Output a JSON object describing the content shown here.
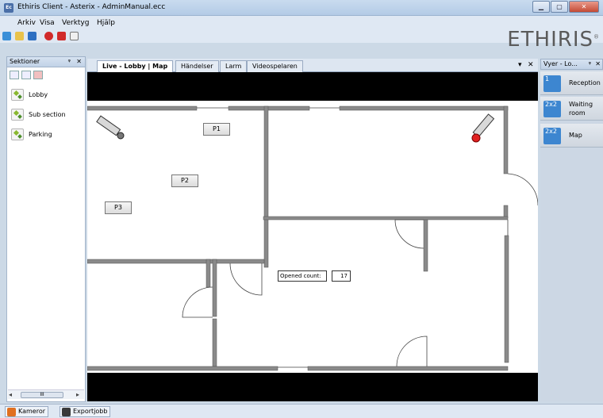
{
  "window": {
    "title": "Ethiris Client - Asterix - AdminManual.ecc",
    "app_icon": "Ec"
  },
  "menu": [
    "Arkiv",
    "Visa",
    "Verktyg",
    "Hjälp"
  ],
  "logo": {
    "text": "ETHIRIS",
    "mark": "®"
  },
  "sections_panel": {
    "title": "Sektioner",
    "items": [
      "Lobby",
      "Sub section",
      "Parking"
    ],
    "scroll_label": "III"
  },
  "tabs": [
    "Live - Lobby | Map",
    "Händelser",
    "Larm",
    "Videospelaren"
  ],
  "views_panel": {
    "title": "Vyer - Lo...",
    "items": [
      {
        "icon_text": "1",
        "label": "Reception"
      },
      {
        "icon_text": "2x2",
        "label": "Waiting room"
      },
      {
        "icon_text": "2x2",
        "label": "Map"
      }
    ]
  },
  "map": {
    "buttons": [
      "P1",
      "P2",
      "P3"
    ],
    "counter_label": "Opened count:",
    "counter_value": "17"
  },
  "bottom_tabs": [
    "Kameror",
    "Exportjobb"
  ],
  "colors": {
    "view_icon": "#3d86d0",
    "wall": "#8a8a8a",
    "camera_alarm": "#e02020"
  }
}
